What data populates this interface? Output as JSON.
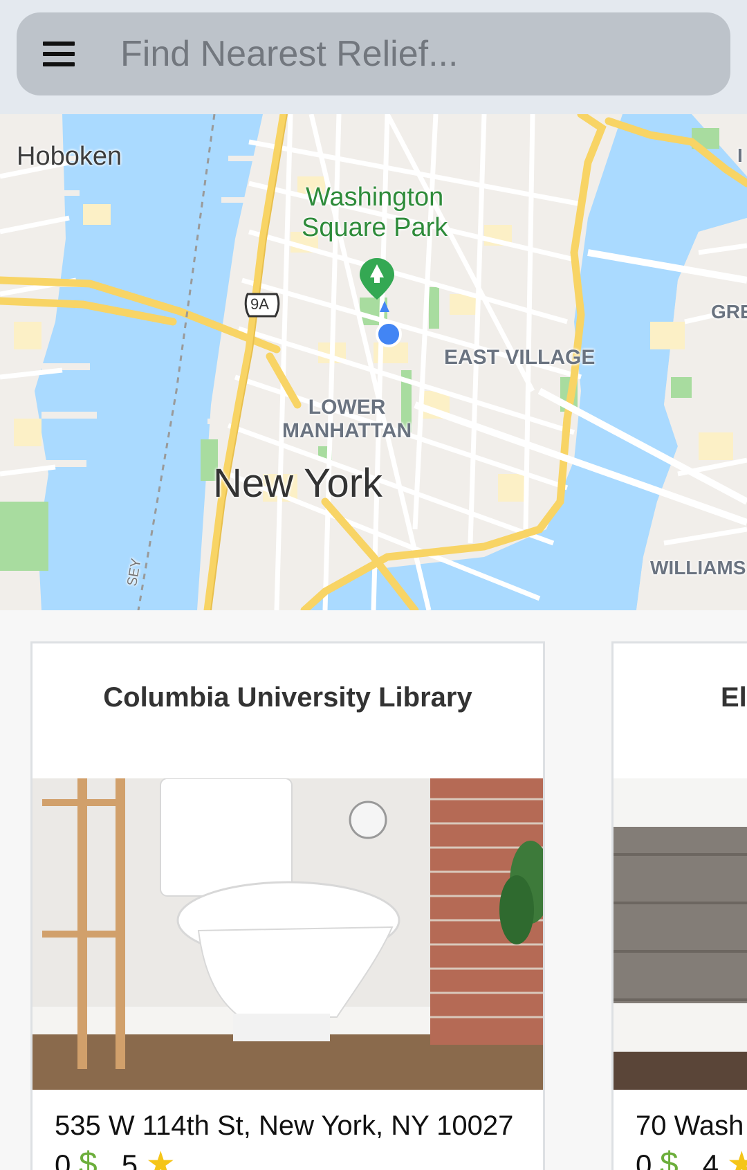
{
  "search": {
    "placeholder": "Find Nearest Relief..."
  },
  "map": {
    "labels": {
      "hoboken": "Hoboken",
      "park_line1": "Washington",
      "park_line2": "Square Park",
      "east_village": "EAST VILLAGE",
      "lower_manhattan_1": "LOWER",
      "lower_manhattan_2": "MANHATTAN",
      "new_york": "New York",
      "williamsburg": "WILLIAMS",
      "greenpoint": "GRE",
      "edge_i": "I",
      "route": "9A",
      "jersey_fragment": "SEY"
    },
    "colors": {
      "water": "#aadaff",
      "land": "#f1eeea",
      "park": "#a8dc9f",
      "major_road": "#f8d465",
      "location": "#4285f4"
    }
  },
  "cards": [
    {
      "title": "Columbia University Library",
      "address": "535 W 114th St, New York, NY 10027",
      "cost": "0",
      "separator": ",",
      "rating": "5"
    },
    {
      "title": "Elı",
      "address": "70 Wash",
      "cost": "0",
      "separator": ",",
      "rating": "4"
    }
  ],
  "icons": {
    "menu": "menu-icon",
    "dollar": "$",
    "star": "★"
  }
}
